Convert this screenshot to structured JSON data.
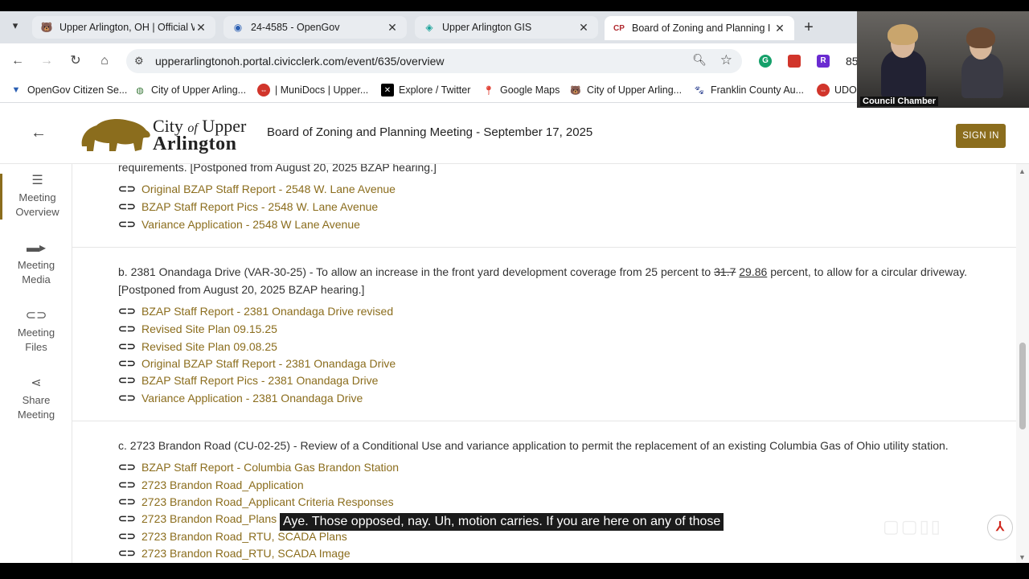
{
  "browser": {
    "tabs": [
      {
        "label": "Upper Arlington, OH | Official W",
        "icon": "bear-icon",
        "active": false
      },
      {
        "label": "24-4585 - OpenGov",
        "icon": "opengov-icon",
        "active": false
      },
      {
        "label": "Upper Arlington GIS",
        "icon": "gis-icon",
        "active": false
      },
      {
        "label": "Board of Zoning and Planning I",
        "icon": "civicclerk-icon",
        "active": true
      }
    ],
    "url": "upperarlingtonoh.portal.civicclerk.com/event/635/overview",
    "extensions": [
      "grammarly-icon",
      "red-extension-icon",
      "r-extension-icon"
    ],
    "ext_partial_text": "85",
    "bookmarks": [
      {
        "label": "OpenGov Citizen Se...",
        "icon": "opengov-icon"
      },
      {
        "label": "City of Upper Arling...",
        "icon": "globe-icon"
      },
      {
        "label": "| MuniDocs | Upper...",
        "icon": "munidocs-icon"
      },
      {
        "label": "Explore / Twitter",
        "icon": "x-icon"
      },
      {
        "label": "Google Maps",
        "icon": "map-pin-icon"
      },
      {
        "label": "City of Upper Arling...",
        "icon": "bear-icon"
      },
      {
        "label": "Franklin County Au...",
        "icon": "paw-icon"
      },
      {
        "label": "UDO",
        "icon": "munidocs-icon"
      }
    ]
  },
  "video": {
    "label": "Council Chamber"
  },
  "header": {
    "logo_line1_a": "City",
    "logo_line1_of": "of",
    "logo_line1_b": "Upper",
    "logo_line2": "Arlington",
    "title": "Board of Zoning and Planning Meeting - September 17, 2025",
    "signin": "SIGN IN"
  },
  "leftnav": [
    {
      "label_1": "Meeting",
      "label_2": "Overview",
      "icon": "list-icon",
      "active": true
    },
    {
      "label_1": "Meeting",
      "label_2": "Media",
      "icon": "video-camera-icon",
      "active": false
    },
    {
      "label_1": "Meeting",
      "label_2": "Files",
      "icon": "paperclip-icon",
      "active": false
    },
    {
      "label_1": "Share",
      "label_2": "Meeting",
      "icon": "share-icon",
      "active": false
    }
  ],
  "items": {
    "a": {
      "tail_text": "requirements. [Postponed from August 20, 2025 BZAP hearing.]",
      "links": [
        "Original BZAP Staff Report - 2548 W. Lane Avenue",
        "BZAP Staff Report Pics - 2548 W. Lane Avenue",
        "Variance Application - 2548 W Lane Avenue"
      ]
    },
    "b": {
      "text_before": "b. 2381 Onandaga Drive (VAR-30-25) - To allow an increase in the front yard development coverage from 25 percent to ",
      "struck": "31.7",
      "inserted": "29.86",
      "text_after": " percent, to allow for a circular driveway.",
      "line2": "[Postponed from August 20, 2025 BZAP hearing.]",
      "links": [
        "BZAP Staff Report - 2381 Onandaga Drive revised",
        "Revised Site Plan 09.15.25",
        "Revised Site Plan 09.08.25",
        "Original BZAP Staff Report - 2381 Onandaga Drive",
        "BZAP Staff Report Pics - 2381 Onandaga Drive",
        "Variance Application - 2381 Onandaga Drive"
      ]
    },
    "c": {
      "text": "c. 2723 Brandon Road (CU-02-25) - Review of a Conditional Use and variance application to permit the replacement of an existing Columbia Gas of Ohio utility station.",
      "links": [
        "BZAP Staff Report - Columbia Gas Brandon Station",
        "2723 Brandon Road_Application",
        "2723 Brandon Road_Applicant Criteria Responses",
        "2723 Brandon Road_Plans",
        "2723 Brandon Road_RTU, SCADA Plans",
        "2723 Brandon Road_RTU, SCADA Image"
      ]
    }
  },
  "caption": "Aye. Those opposed, nay. Uh, motion carries. If you are here on any of those",
  "colors": {
    "accent": "#8b6d1d",
    "tabstrip": "#dfe3e8"
  }
}
